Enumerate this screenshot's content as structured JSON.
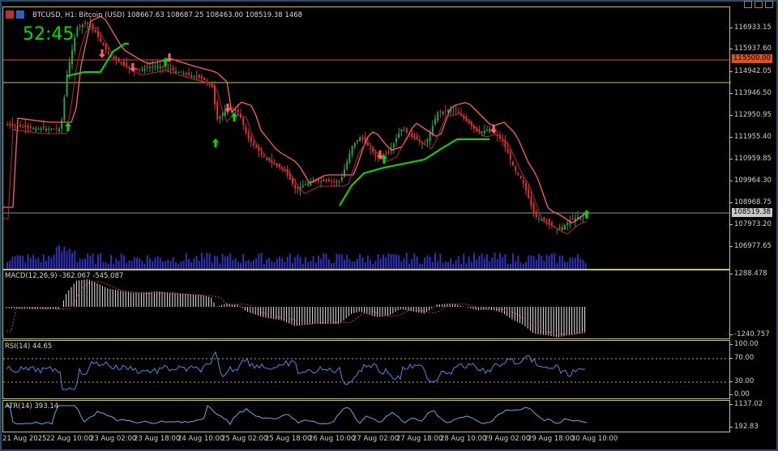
{
  "header": {
    "symbol_info": "BTCUSD, H1:  Bitcoin (USD)  108667.63  108687.25  108463.00  108519.38  1468",
    "timer": "52:45"
  },
  "price_scale": {
    "ticks": [
      "116933.15",
      "115937.60",
      "114942.05",
      "113946.50",
      "112950.95",
      "111955.40",
      "110959.85",
      "109964.30",
      "108968.75",
      "107973.20",
      "106977.65"
    ],
    "tag_red": "115500.00",
    "tag_current": "108519.38"
  },
  "macd": {
    "label": "MACD(12,26,9) -362.067 -545.087",
    "top": "1288.478",
    "bottom": "-1240.757"
  },
  "rsi": {
    "label": "RSI(14) 44.65",
    "ticks": [
      "100.00",
      "70.00",
      "30.00",
      "0.00"
    ]
  },
  "atr": {
    "label": "ATR(14) 393.14",
    "top": "1137.02",
    "bottom": "192.83"
  },
  "time_axis": [
    "21 Aug 2025",
    "22 Aug 10:00",
    "23 Aug 02:00",
    "23 Aug 18:00",
    "24 Aug 10:00",
    "25 Aug 02:00",
    "25 Aug 18:00",
    "26 Aug 10:00",
    "27 Aug 02:00",
    "27 Aug 18:00",
    "28 Aug 10:00",
    "29 Aug 02:00",
    "29 Aug 18:00",
    "30 Aug 10:00"
  ],
  "colors": {
    "up": "#2ea043",
    "down": "#e03030",
    "ma": "#ff6060",
    "trend": "#00e000",
    "rsi": "#4a8ae8",
    "atr": "#5ab0e8",
    "volume": "#3030c0",
    "frame": "#c8c850"
  }
}
